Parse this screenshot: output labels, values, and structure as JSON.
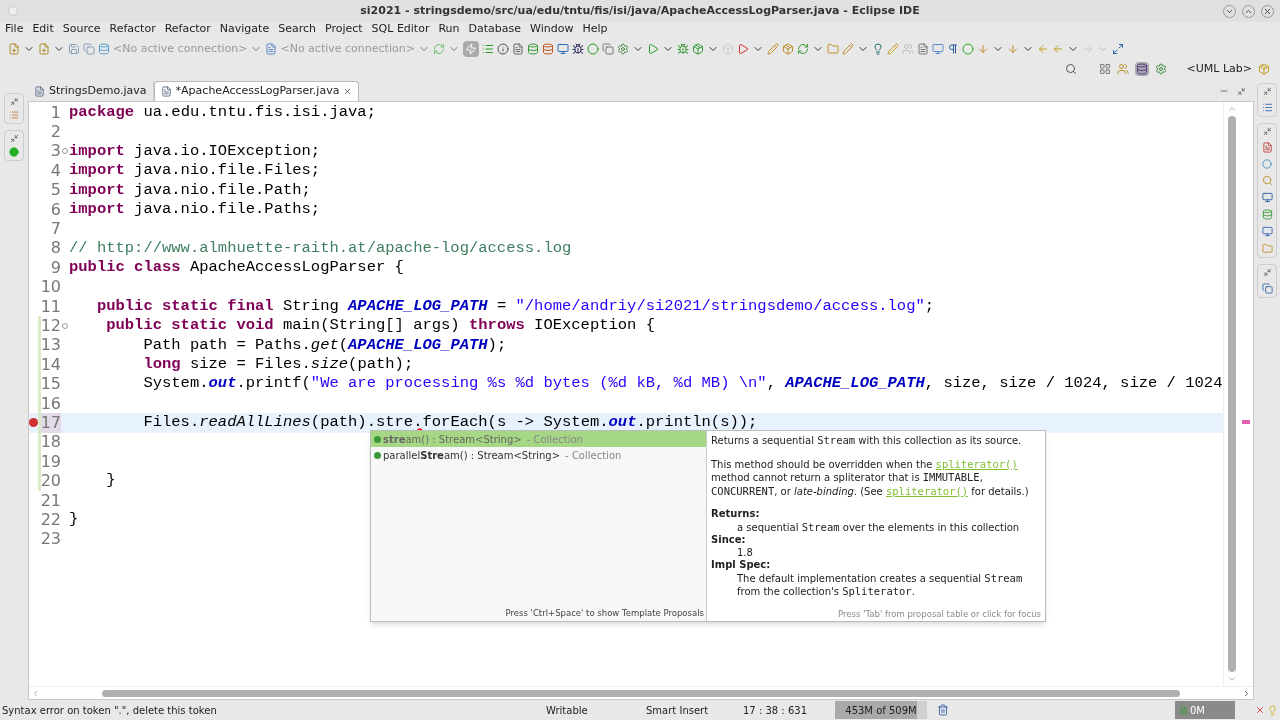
{
  "window": {
    "title": "si2021 - stringsdemo/src/ua/edu/tntu/fis/isi/java/ApacheAccessLogParser.java - Eclipse IDE"
  },
  "menu": [
    "File",
    "Edit",
    "Source",
    "Refactor",
    "Refactor",
    "Navigate",
    "Search",
    "Project",
    "SQL Editor",
    "Run",
    "Database",
    "Window",
    "Help"
  ],
  "toolbar": {
    "connections": [
      "<No active connection>",
      "<No active connection>"
    ],
    "perspective": "<UML Lab>"
  },
  "tabs": [
    {
      "label": "StringsDemo.java",
      "selected": false
    },
    {
      "label": "*ApacheAccessLogParser.java",
      "selected": true
    }
  ],
  "editor": {
    "lines": [
      {
        "number": "1",
        "fold": false,
        "changed": false,
        "error": false,
        "current": false,
        "tokens": [
          {
            "kind": "kw",
            "text": "package"
          },
          {
            "kind": "plain",
            "text": " ua.edu.tntu.fis.isi.java;"
          }
        ]
      },
      {
        "number": "2",
        "fold": false,
        "changed": false,
        "error": false,
        "current": false
      },
      {
        "number": "3",
        "fold": true,
        "changed": false,
        "error": false,
        "current": false,
        "tokens": [
          {
            "kind": "kw",
            "text": "import"
          },
          {
            "kind": "plain",
            "text": " java.io.IOException;"
          }
        ]
      },
      {
        "number": "4",
        "fold": false,
        "changed": false,
        "error": false,
        "current": false,
        "tokens": [
          {
            "kind": "kw",
            "text": "import"
          },
          {
            "kind": "plain",
            "text": " java.nio.file.Files;"
          }
        ]
      },
      {
        "number": "5",
        "fold": false,
        "changed": false,
        "error": false,
        "current": false,
        "tokens": [
          {
            "kind": "kw",
            "text": "import"
          },
          {
            "kind": "plain",
            "text": " java.nio.file.Path;"
          }
        ]
      },
      {
        "number": "6",
        "fold": false,
        "changed": false,
        "error": false,
        "current": false,
        "tokens": [
          {
            "kind": "kw",
            "text": "import"
          },
          {
            "kind": "plain",
            "text": " java.nio.file.Paths;"
          }
        ]
      },
      {
        "number": "7",
        "fold": false,
        "changed": false,
        "error": false,
        "current": false
      },
      {
        "number": "8",
        "fold": false,
        "changed": false,
        "error": false,
        "current": false,
        "tokens": [
          {
            "kind": "comment",
            "text": "// http://www.almhuette-raith.at/apache-log/access.log"
          }
        ]
      },
      {
        "number": "9",
        "fold": false,
        "changed": false,
        "error": false,
        "current": false,
        "tokens": [
          {
            "kind": "kw",
            "text": "public class"
          },
          {
            "kind": "plain",
            "text": " ApacheAccessLogParser {"
          }
        ]
      },
      {
        "number": "10",
        "fold": false,
        "changed": false,
        "error": false,
        "current": false
      },
      {
        "number": "11",
        "fold": false,
        "changed": false,
        "error": false,
        "current": false,
        "tokens": [
          {
            "kind": "kw",
            "text": "   public static final"
          },
          {
            "kind": "plain",
            "text": " String "
          },
          {
            "kind": "const",
            "text": "APACHE_LOG_PATH"
          },
          {
            "kind": "plain",
            "text": " = "
          },
          {
            "kind": "str",
            "text": "\"/home/andriy/si2021/stringsdemo/access.log\""
          },
          {
            "kind": "plain",
            "text": ";"
          }
        ]
      },
      {
        "number": "12",
        "fold": true,
        "changed": true,
        "error": false,
        "current": false,
        "tokens": [
          {
            "kind": "kw",
            "text": "    public static void"
          },
          {
            "kind": "plain",
            "text": " main(String[] args) "
          },
          {
            "kind": "kw",
            "text": "throws"
          },
          {
            "kind": "plain",
            "text": " IOException {"
          }
        ]
      },
      {
        "number": "13",
        "fold": false,
        "changed": true,
        "error": false,
        "current": false,
        "tokens": [
          {
            "kind": "plain",
            "text": "        Path path = Paths."
          },
          {
            "kind": "static",
            "text": "get"
          },
          {
            "kind": "plain",
            "text": "("
          },
          {
            "kind": "const",
            "text": "APACHE_LOG_PATH"
          },
          {
            "kind": "plain",
            "text": ");"
          }
        ]
      },
      {
        "number": "14",
        "fold": false,
        "changed": true,
        "error": false,
        "current": false,
        "tokens": [
          {
            "kind": "kw",
            "text": "        long"
          },
          {
            "kind": "plain",
            "text": " size = Files."
          },
          {
            "kind": "static",
            "text": "size"
          },
          {
            "kind": "plain",
            "text": "(path);"
          }
        ]
      },
      {
        "number": "15",
        "fold": false,
        "changed": true,
        "error": false,
        "current": false,
        "tokens": [
          {
            "kind": "plain",
            "text": "        System."
          },
          {
            "kind": "const",
            "text": "out"
          },
          {
            "kind": "plain",
            "text": ".printf("
          },
          {
            "kind": "str",
            "text": "\"We are processing %s %d bytes (%d kB, %d MB) \\n\""
          },
          {
            "kind": "plain",
            "text": ", "
          },
          {
            "kind": "const",
            "text": "APACHE_LOG_PATH"
          },
          {
            "kind": "plain",
            "text": ", size, size / 1024, size / 1024"
          }
        ]
      },
      {
        "number": "16",
        "fold": false,
        "changed": true,
        "error": false,
        "current": false
      },
      {
        "number": "17",
        "fold": false,
        "changed": true,
        "error": true,
        "current": true,
        "tokens": [
          {
            "kind": "plain",
            "text": "        Files."
          },
          {
            "kind": "static",
            "text": "readAllLines"
          },
          {
            "kind": "plain",
            "text": "(path).stre"
          },
          {
            "kind": "error",
            "text": "."
          },
          {
            "kind": "plain",
            "text": "forEach(s -> System."
          },
          {
            "kind": "const",
            "text": "out"
          },
          {
            "kind": "plain",
            "text": ".println(s));"
          }
        ]
      },
      {
        "number": "18",
        "fold": false,
        "changed": true,
        "error": false,
        "current": false
      },
      {
        "number": "19",
        "fold": false,
        "changed": true,
        "error": false,
        "current": false
      },
      {
        "number": "20",
        "fold": false,
        "changed": true,
        "error": false,
        "current": false,
        "tokens": [
          {
            "kind": "plain",
            "text": "    }"
          }
        ]
      },
      {
        "number": "21",
        "fold": false,
        "changed": false,
        "error": false,
        "current": false
      },
      {
        "number": "22",
        "fold": false,
        "changed": false,
        "error": false,
        "current": false,
        "tokens": [
          {
            "kind": "plain",
            "text": "}"
          }
        ]
      },
      {
        "number": "23",
        "fold": false,
        "changed": false,
        "error": false,
        "current": false
      }
    ]
  },
  "completion": {
    "proposals": [
      {
        "text": "**stre**am() : Stream<String>",
        "qualifier": "- Collection",
        "selected": true
      },
      {
        "text": "parallel**Stre**am() : Stream<String>",
        "qualifier": "- Collection",
        "selected": false
      }
    ],
    "hint": "Press 'Ctrl+Space' to show Template Proposals",
    "doc": {
      "paragraphs": [
        [
          {
            "kind": "text",
            "text": "Returns a sequential "
          },
          {
            "kind": "code",
            "text": "Stream"
          },
          {
            "kind": "text",
            "text": " with this collection as its source."
          }
        ],
        [
          {
            "kind": "text",
            "text": "This method should be overridden when the "
          },
          {
            "kind": "link",
            "text": "spliterator()"
          },
          {
            "kind": "text",
            "text": " method cannot return a spliterator that is "
          },
          {
            "kind": "code",
            "text": "IMMUTABLE"
          },
          {
            "kind": "text",
            "text": ", "
          },
          {
            "kind": "code",
            "text": "CONCURRENT"
          },
          {
            "kind": "text",
            "text": ", or "
          },
          {
            "kind": "italic",
            "text": "late-binding"
          },
          {
            "kind": "text",
            "text": ". (See "
          },
          {
            "kind": "link",
            "text": "spliterator()"
          },
          {
            "kind": "text",
            "text": " for details.)"
          }
        ]
      ],
      "sections": [
        {
          "heading": "Returns:",
          "parts": [
            {
              "kind": "text",
              "text": "a sequential "
            },
            {
              "kind": "code",
              "text": "Stream"
            },
            {
              "kind": "text",
              "text": " over the elements in this collection"
            }
          ]
        },
        {
          "heading": "Since:",
          "parts": [
            {
              "kind": "text",
              "text": "1.8"
            }
          ]
        },
        {
          "heading": "Impl Spec:",
          "parts": [
            {
              "kind": "text",
              "text": "The default implementation creates a sequential "
            },
            {
              "kind": "code",
              "text": "Stream"
            },
            {
              "kind": "text",
              "text": " from the collection's "
            },
            {
              "kind": "code",
              "text": "Spliterator"
            },
            {
              "kind": "text",
              "text": "."
            }
          ]
        }
      ],
      "footer": "Press 'Tab' from proposal table or click for focus"
    }
  },
  "status_bar": {
    "message": "Syntax error on token \".\", delete this token",
    "mode": "Writable",
    "insert": "Smart Insert",
    "position": "17 : 38 : 631",
    "heap": {
      "text": "453M of 509M",
      "level": 0.89
    },
    "other": "0M"
  }
}
